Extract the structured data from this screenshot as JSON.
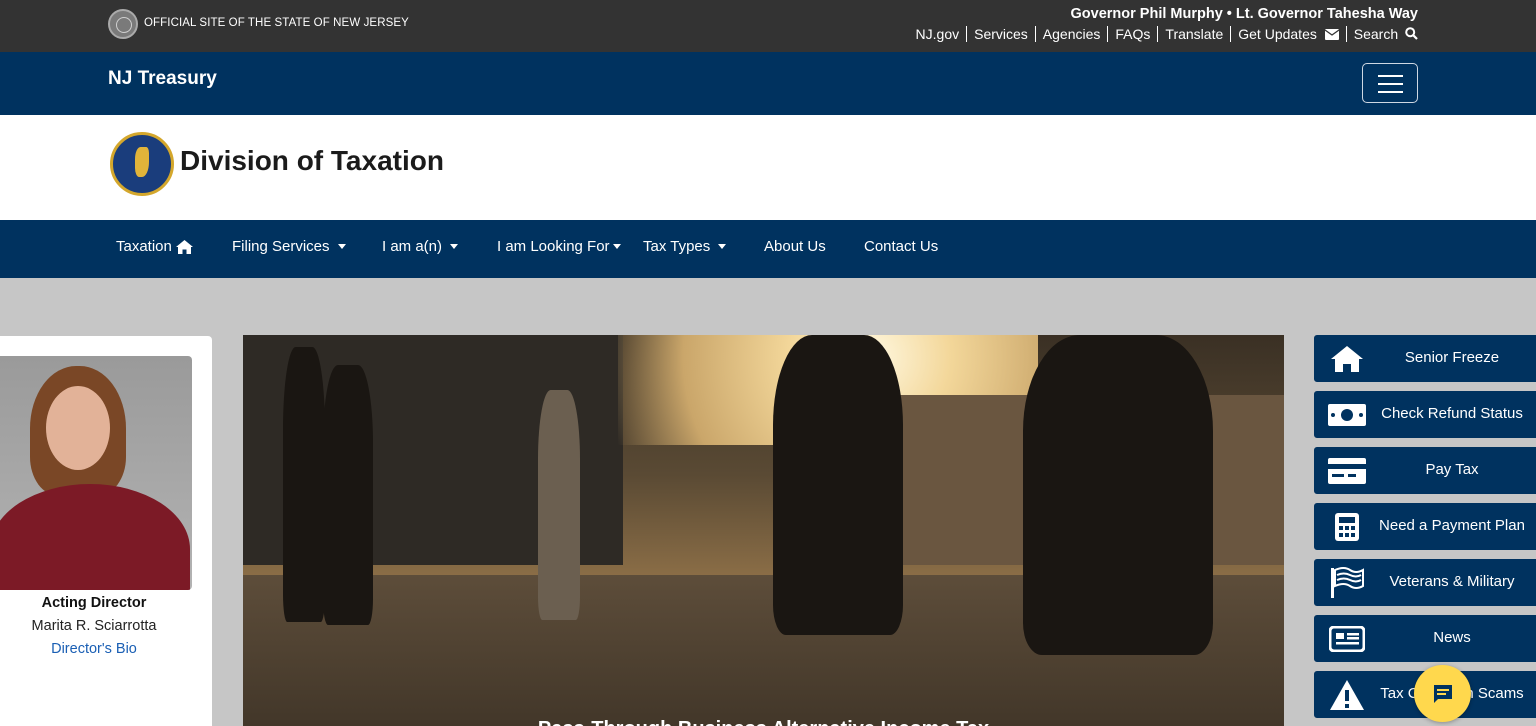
{
  "topbar": {
    "official": "OFFICIAL SITE OF THE STATE OF NEW JERSEY",
    "governor": "Governor Phil Murphy • Lt. Governor Tahesha Way",
    "links": [
      "NJ.gov",
      "Services",
      "Agencies",
      "FAQs",
      "Translate",
      "Get Updates",
      "Search"
    ]
  },
  "treasury": {
    "title": "NJ Treasury"
  },
  "header": {
    "title": "Division of Taxation"
  },
  "nav": {
    "items": [
      "Taxation",
      "Filing Services",
      "I am a(n)",
      "I am Looking For",
      "Tax Types",
      "About Us",
      "Contact Us"
    ]
  },
  "director": {
    "role": "Acting Director",
    "name": "Marita R. Sciarrotta",
    "bio_link": "Director's Bio"
  },
  "hero": {
    "caption": "Pass-Through Business Alternative Income Tax"
  },
  "quick_links": [
    {
      "label": "Senior Freeze",
      "icon": "home-icon"
    },
    {
      "label": "Check Refund Status",
      "icon": "money-icon"
    },
    {
      "label": "Pay Tax",
      "icon": "credit-card-icon"
    },
    {
      "label": "Need a Payment Plan",
      "icon": "calculator-icon"
    },
    {
      "label": "Veterans & Military",
      "icon": "flag-icon"
    },
    {
      "label": "News",
      "icon": "newspaper-icon"
    },
    {
      "label": "Tax Collection Scams",
      "icon": "warning-icon"
    }
  ],
  "colors": {
    "navy": "#00325f",
    "topbar": "#333333",
    "chat": "#ffd84d",
    "link": "#1a5fb4"
  }
}
